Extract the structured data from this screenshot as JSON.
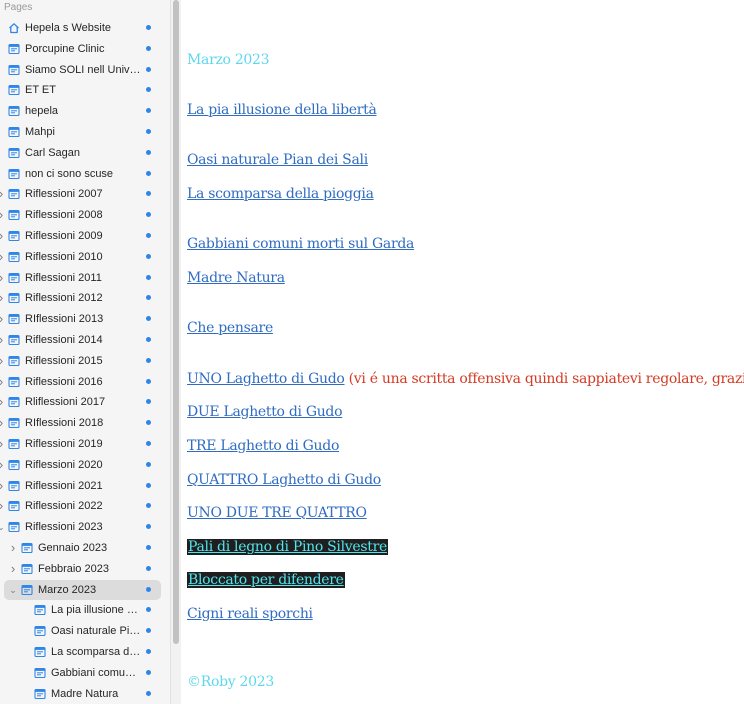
{
  "sidebar": {
    "header": "Pages",
    "items": [
      {
        "label": "Hepela s Website",
        "icon": "home-icon",
        "level": 0,
        "chevron": "none"
      },
      {
        "label": "Porcupine Clinic",
        "icon": "page-icon",
        "level": 0,
        "chevron": "none"
      },
      {
        "label": "Siamo SOLI nell Universo?",
        "icon": "page-icon",
        "level": 0,
        "chevron": "none"
      },
      {
        "label": "ET ET",
        "icon": "page-icon",
        "level": 0,
        "chevron": "none"
      },
      {
        "label": "hepela",
        "icon": "page-icon",
        "level": 0,
        "chevron": "none"
      },
      {
        "label": "Mahpi",
        "icon": "page-icon",
        "level": 0,
        "chevron": "none"
      },
      {
        "label": "Carl Sagan",
        "icon": "page-icon",
        "level": 0,
        "chevron": "none"
      },
      {
        "label": "non ci sono scuse",
        "icon": "page-icon",
        "level": 0,
        "chevron": "none"
      },
      {
        "label": "Riflessioni 2007",
        "icon": "page-icon",
        "level": 0,
        "chevron": "right"
      },
      {
        "label": "Riflessioni 2008",
        "icon": "page-icon",
        "level": 0,
        "chevron": "right"
      },
      {
        "label": "Riflessioni 2009",
        "icon": "page-icon",
        "level": 0,
        "chevron": "right"
      },
      {
        "label": "Riflessioni 2010",
        "icon": "page-icon",
        "level": 0,
        "chevron": "right"
      },
      {
        "label": "Riflessioni 2011",
        "icon": "page-icon",
        "level": 0,
        "chevron": "right"
      },
      {
        "label": "Riflessioni 2012",
        "icon": "page-icon",
        "level": 0,
        "chevron": "right"
      },
      {
        "label": "RIflessioni 2013",
        "icon": "page-icon",
        "level": 0,
        "chevron": "right"
      },
      {
        "label": "Riflessioni 2014",
        "icon": "page-icon",
        "level": 0,
        "chevron": "right"
      },
      {
        "label": "Riflessioni 2015",
        "icon": "page-icon",
        "level": 0,
        "chevron": "right"
      },
      {
        "label": "Riflessioni 2016",
        "icon": "page-icon",
        "level": 0,
        "chevron": "right"
      },
      {
        "label": "Rliflessioni 2017",
        "icon": "page-icon",
        "level": 0,
        "chevron": "right"
      },
      {
        "label": "RIflessioni 2018",
        "icon": "page-icon",
        "level": 0,
        "chevron": "right"
      },
      {
        "label": "Riflessioni 2019",
        "icon": "page-icon",
        "level": 0,
        "chevron": "right"
      },
      {
        "label": "Riflessioni 2020",
        "icon": "page-icon",
        "level": 0,
        "chevron": "right"
      },
      {
        "label": "Riflessioni 2021",
        "icon": "page-icon",
        "level": 0,
        "chevron": "right"
      },
      {
        "label": "Riflessioni 2022",
        "icon": "page-icon",
        "level": 0,
        "chevron": "right"
      },
      {
        "label": "Riflessioni 2023",
        "icon": "page-icon",
        "level": 0,
        "chevron": "down"
      },
      {
        "label": "Gennaio 2023",
        "icon": "page-icon",
        "level": 1,
        "chevron": "right"
      },
      {
        "label": "Febbraio 2023",
        "icon": "page-icon",
        "level": 1,
        "chevron": "right"
      },
      {
        "label": "Marzo 2023",
        "icon": "page-icon",
        "level": 1,
        "chevron": "down",
        "selected": true
      },
      {
        "label": "La pia illusione della libertà",
        "icon": "page-icon",
        "level": 2,
        "chevron": "none"
      },
      {
        "label": "Oasi naturale Pian dei Sali",
        "icon": "page-icon",
        "level": 2,
        "chevron": "none"
      },
      {
        "label": "La scomparsa della pioggia",
        "icon": "page-icon",
        "level": 2,
        "chevron": "none"
      },
      {
        "label": "Gabbiani comuni morti sul Garda",
        "icon": "page-icon",
        "level": 2,
        "chevron": "none"
      },
      {
        "label": "Madre Natura",
        "icon": "page-icon",
        "level": 2,
        "chevron": "none"
      }
    ]
  },
  "content": {
    "title": "Marzo 2023",
    "links": [
      {
        "text": "La pia illusione della libertà",
        "style": "link"
      },
      {
        "text": "Oasi naturale Pian dei Sali",
        "style": "link"
      },
      {
        "text": "La scomparsa della pioggia",
        "style": "link"
      },
      {
        "text": "Gabbiani comuni morti sul Garda",
        "style": "link"
      },
      {
        "text": "Madre Natura",
        "style": "link"
      },
      {
        "text": "Che pensare",
        "style": "link"
      },
      {
        "text": "UNO Laghetto di Gudo",
        "style": "link",
        "note": " (vi é una scritta offensiva quindi sappiatevi regolare, grazie)"
      },
      {
        "text": "DUE Laghetto di Gudo",
        "style": "link"
      },
      {
        "text": "TRE Laghetto di Gudo",
        "style": "link"
      },
      {
        "text": "QUATTRO Laghetto di Gudo",
        "style": "link"
      },
      {
        "text": "UNO DUE TRE QUATTRO",
        "style": "link"
      },
      {
        "text": "Pali di legno di Pino Silvestre",
        "style": "highlight"
      },
      {
        "text": "Bloccato per difendere",
        "style": "highlight"
      },
      {
        "text": "Cigni reali sporchi",
        "style": "link"
      }
    ],
    "footer": "©Roby 2023"
  },
  "colors": {
    "link": "#2f6cc2",
    "title": "#5ed7ee",
    "note": "#d43a24",
    "highlight_bg": "#1f1f1f",
    "highlight_text": "#52e5ee",
    "status_dot": "#2f86e8"
  }
}
